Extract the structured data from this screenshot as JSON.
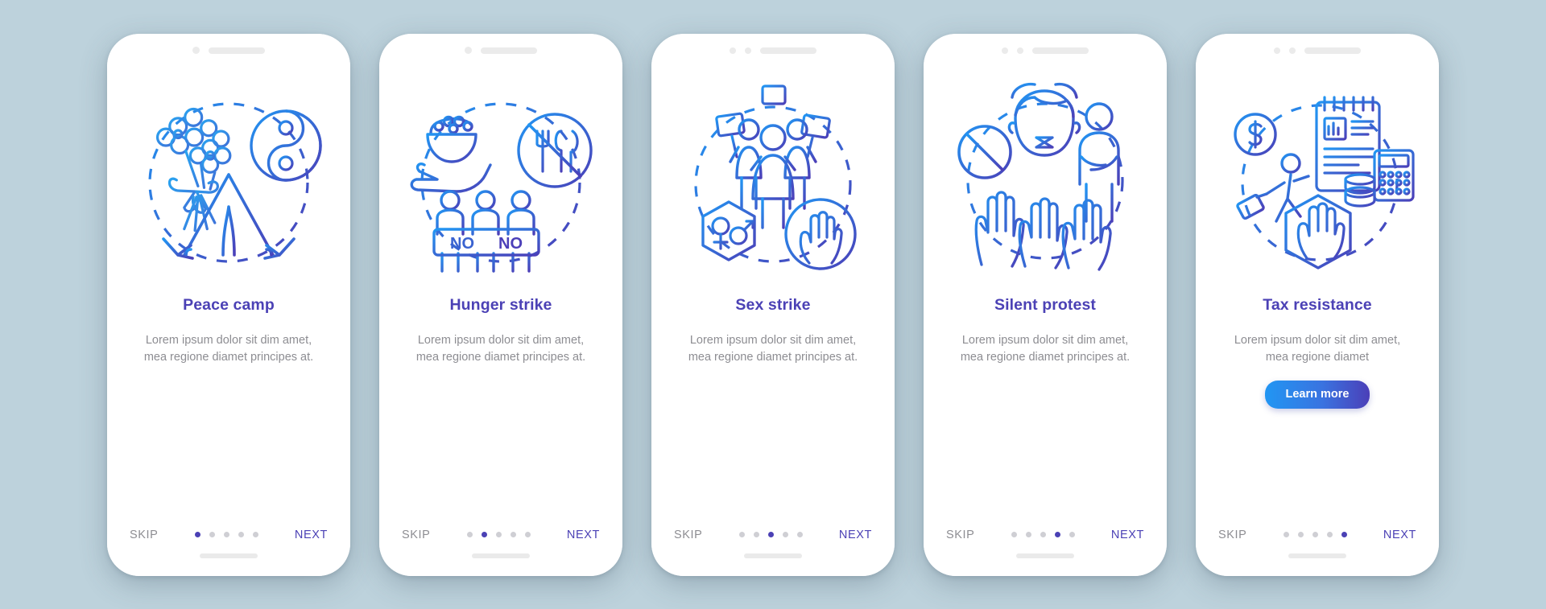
{
  "background_color": "#bdd2dc",
  "theme": {
    "title_color": "#4b41b5",
    "body_color": "#8d8d92",
    "next_color": "#4b41b5",
    "skip_color": "#8d8d92",
    "dot_active_color": "#4b41b5",
    "dot_inactive_color": "#cfcfd4",
    "button_gradient_start": "#2196f3",
    "button_gradient_end": "#4b3fb8",
    "icon_gradient_start": "#2196f3",
    "icon_gradient_end": "#4b3fb8"
  },
  "common": {
    "skip_label": "SKIP",
    "next_label": "NEXT",
    "dot_count": 5
  },
  "screens": [
    {
      "id": "peace-camp",
      "title": "Peace camp",
      "description": "Lorem ipsum dolor sit dim amet, mea regione diamet principes at.",
      "active_dot": 1,
      "icons": [
        "flower-bouquet-icon",
        "yin-yang-icon",
        "tent-icon",
        "dashed-circle-icon"
      ],
      "has_learn_more": false,
      "notch_dots": 1
    },
    {
      "id": "hunger-strike",
      "title": "Hunger strike",
      "description": "Lorem ipsum dolor sit dim amet, mea regione diamet principes at.",
      "active_dot": 2,
      "icons": [
        "rice-bowl-hand-icon",
        "no-cutlery-icon",
        "protest-banner-no-no-icon",
        "dashed-circle-icon"
      ],
      "banner_text_left": "NO",
      "banner_text_right": "NO",
      "has_learn_more": false,
      "notch_dots": 2
    },
    {
      "id": "sex-strike",
      "title": "Sex strike",
      "description": "Lorem ipsum dolor sit dim amet, mea regione diamet principes at.",
      "active_dot": 3,
      "icons": [
        "protesters-with-placards-icon",
        "gender-symbols-hexagon-icon",
        "stop-hand-circle-icon",
        "dashed-circle-icon"
      ],
      "has_learn_more": false,
      "notch_dots": 2
    },
    {
      "id": "silent-protest",
      "title": "Silent protest",
      "description": "Lorem ipsum dolor sit dim amet, mea regione diamet principes at.",
      "active_dot": 4,
      "icons": [
        "prohibition-sign-icon",
        "taped-mouth-face-icon",
        "crossed-arms-person-icon",
        "raised-hands-icon",
        "dashed-circle-icon"
      ],
      "has_learn_more": false,
      "notch_dots": 2
    },
    {
      "id": "tax-resistance",
      "title": "Tax resistance",
      "description": "Lorem ipsum dolor sit dim amet, mea regione diamet",
      "active_dot": 5,
      "icons": [
        "dollar-coin-icon",
        "walking-person-suitcase-icon",
        "document-chart-icon",
        "calculator-icon",
        "coins-stack-icon",
        "stop-hand-hexagon-icon",
        "dashed-circle-icon"
      ],
      "has_learn_more": true,
      "learn_more_label": "Learn more",
      "notch_dots": 2
    }
  ]
}
